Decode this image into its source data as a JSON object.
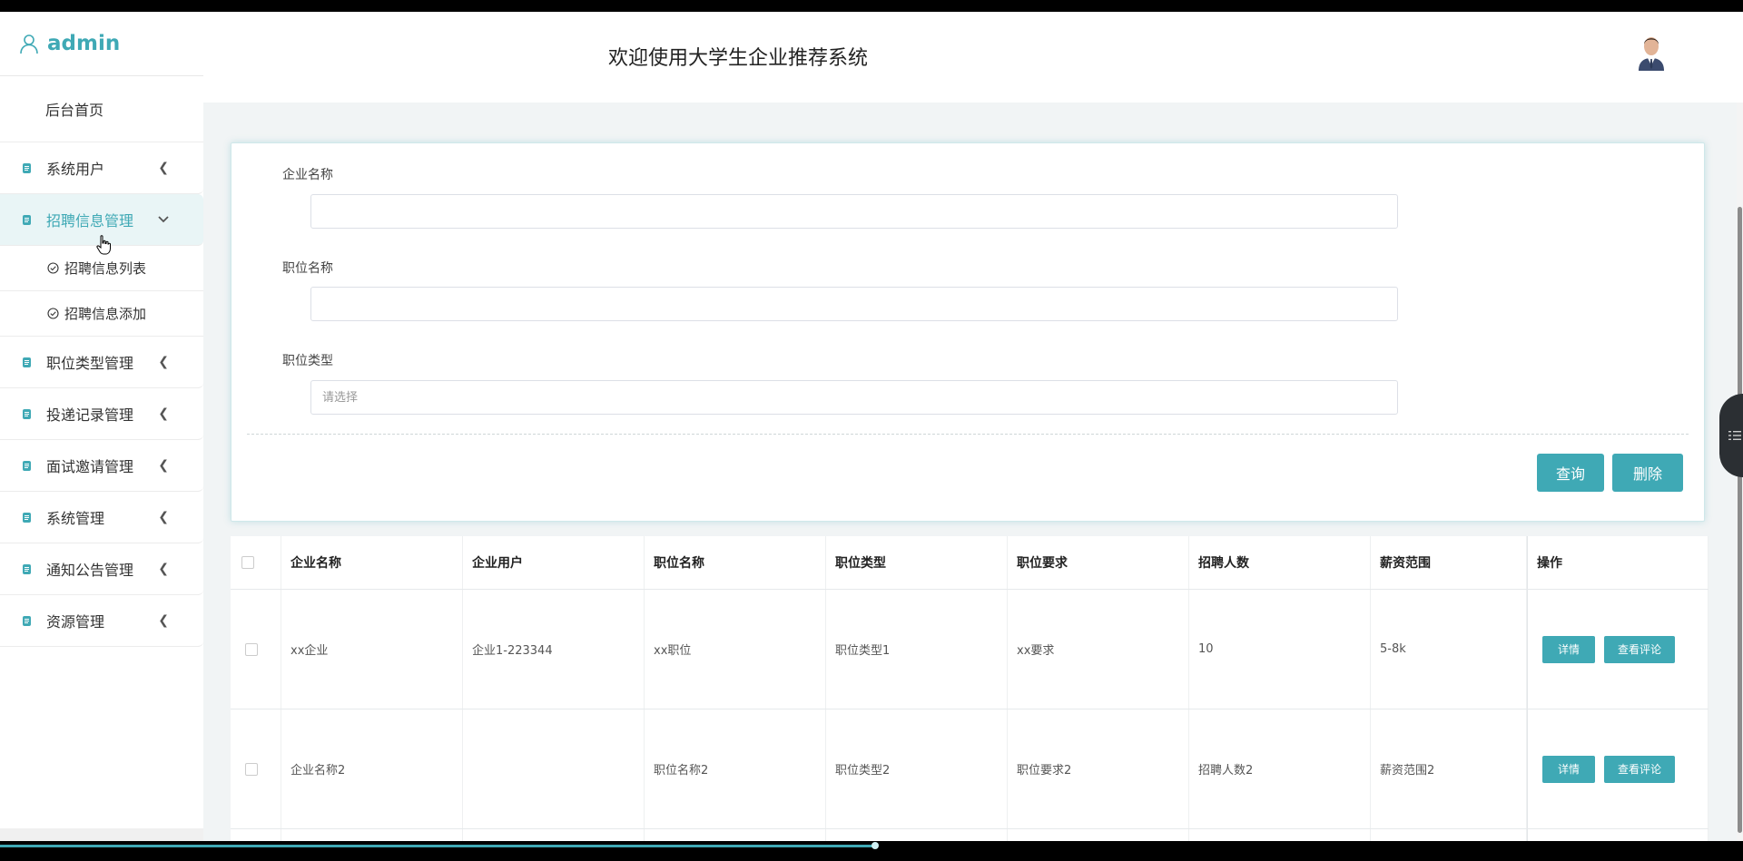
{
  "app": {
    "user": "admin",
    "header_title": "欢迎使用大学生企业推荐系统"
  },
  "sidebar": {
    "home": "后台首页",
    "items": [
      {
        "label": "系统用户"
      },
      {
        "label": "招聘信息管理",
        "expanded": true,
        "children": [
          "招聘信息列表",
          "招聘信息添加"
        ]
      },
      {
        "label": "职位类型管理"
      },
      {
        "label": "投递记录管理"
      },
      {
        "label": "面试邀请管理"
      },
      {
        "label": "系统管理"
      },
      {
        "label": "通知公告管理"
      },
      {
        "label": "资源管理"
      }
    ]
  },
  "search": {
    "company_label": "企业名称",
    "company_value": "",
    "position_label": "职位名称",
    "position_value": "",
    "type_label": "职位类型",
    "type_placeholder": "请选择",
    "query_button": "查询",
    "delete_button": "删除"
  },
  "table": {
    "headers": [
      "企业名称",
      "企业用户",
      "职位名称",
      "职位类型",
      "职位要求",
      "招聘人数",
      "薪资范围",
      "操作"
    ],
    "rows": [
      [
        "xx企业",
        "企业1-223344",
        "xx职位",
        "职位类型1",
        "xx要求",
        "10",
        "5-8k"
      ],
      [
        "企业名称2",
        "",
        "职位名称2",
        "职位类型2",
        "职位要求2",
        "招聘人数2",
        "薪资范围2"
      ]
    ],
    "detail_button": "详情",
    "review_button": "查看评论"
  },
  "colors": {
    "accent": "#3fa9b5"
  }
}
